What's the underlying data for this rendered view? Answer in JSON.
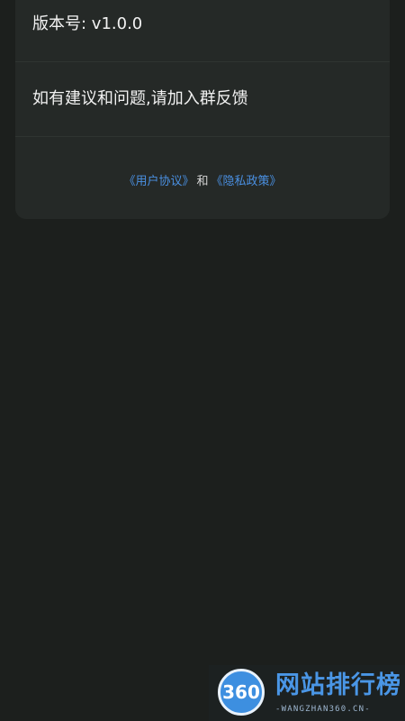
{
  "about": {
    "version_text": "版本号: v1.0.0",
    "feedback_text": "如有建议和问题,请加入群反馈"
  },
  "footer_links": {
    "user_agreement": "《用户协议》",
    "conjunction": "和",
    "privacy_policy": "《隐私政策》"
  },
  "watermark": {
    "badge_text": "360",
    "title": "网站排行榜",
    "subtitle": "-WANGZHAN360.CN-"
  },
  "colors": {
    "background": "#1c1f1d",
    "card": "#252927",
    "link": "#4a90e2"
  }
}
